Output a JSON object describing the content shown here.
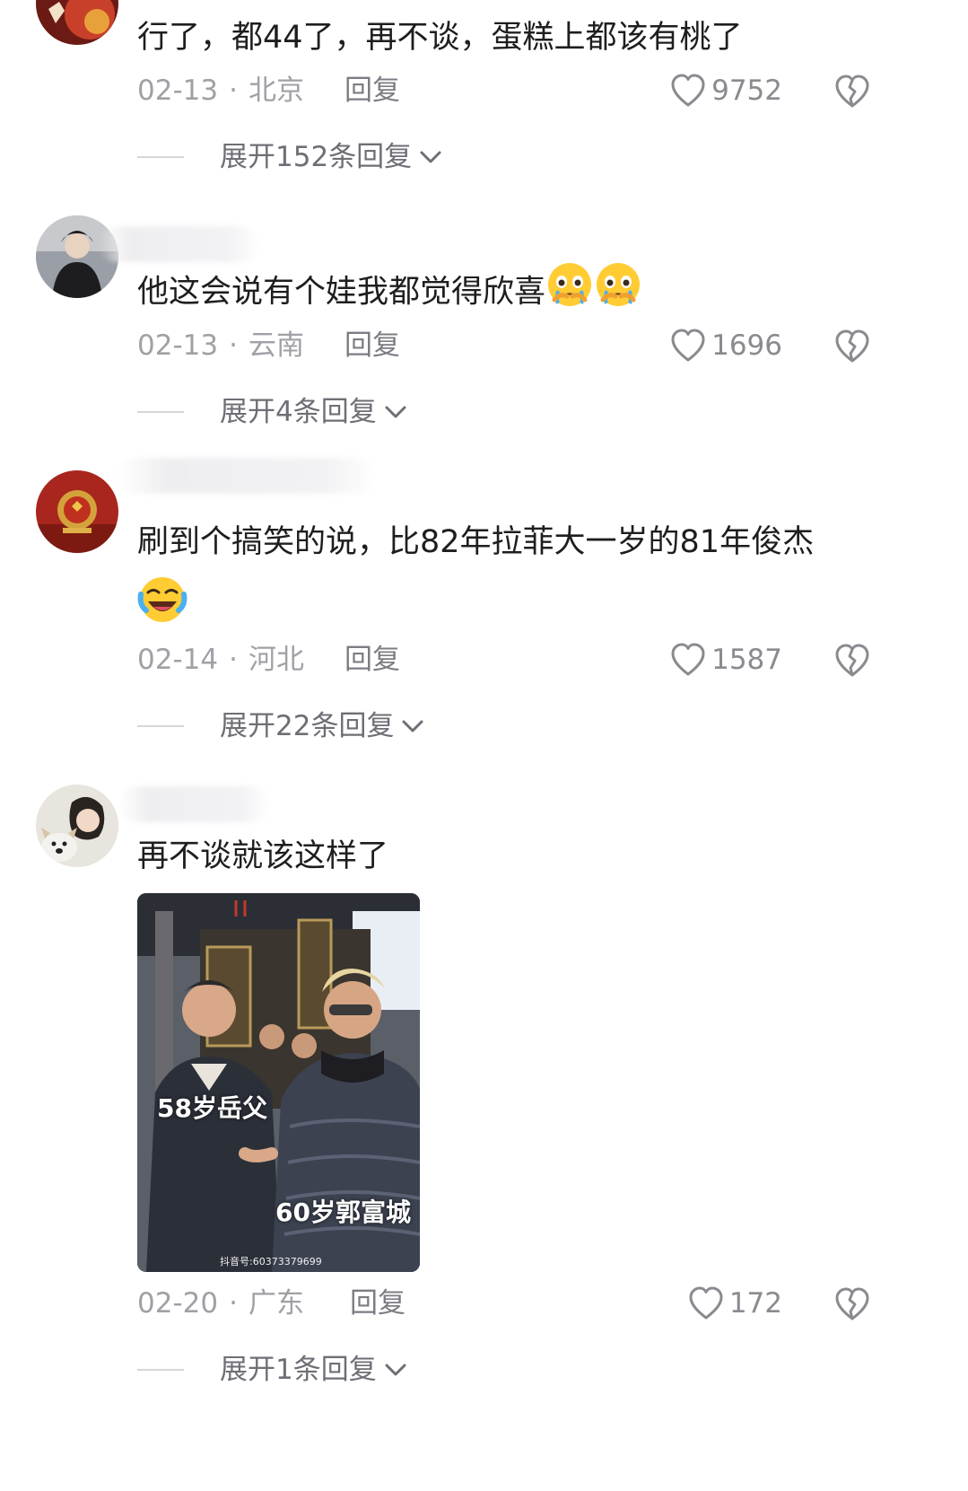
{
  "comments": [
    {
      "text": "行了，都44了，再不谈，蛋糕上都该有桃了",
      "date": "02-13",
      "location": "北京",
      "reply_label": "回复",
      "likes": "9752",
      "expand_label": "展开152条回复"
    },
    {
      "text": "他这会说有个娃我都觉得欣喜",
      "emoji": [
        "crying-face-emoji",
        "crying-face-emoji"
      ],
      "date": "02-13",
      "location": "云南",
      "reply_label": "回复",
      "likes": "1696",
      "expand_label": "展开4条回复"
    },
    {
      "text": "刷到个搞笑的说，比82年拉菲大一岁的81年俊杰",
      "emoji": [
        "laughing-tears-emoji"
      ],
      "date": "02-14",
      "location": "河北",
      "reply_label": "回复",
      "likes": "1587",
      "expand_label": "展开22条回复"
    },
    {
      "text": "再不谈就该这样了",
      "image": {
        "label_left": "58岁岳父",
        "label_right": "60岁郭富城",
        "watermark": "抖音号:60373379699"
      },
      "date": "02-20",
      "location": "广东",
      "reply_label": "回复",
      "likes": "172",
      "expand_label": "展开1条回复"
    }
  ],
  "colors": {
    "meta": "#a0a0a6",
    "text": "#1e1e1e",
    "icon": "#8a8a90"
  }
}
